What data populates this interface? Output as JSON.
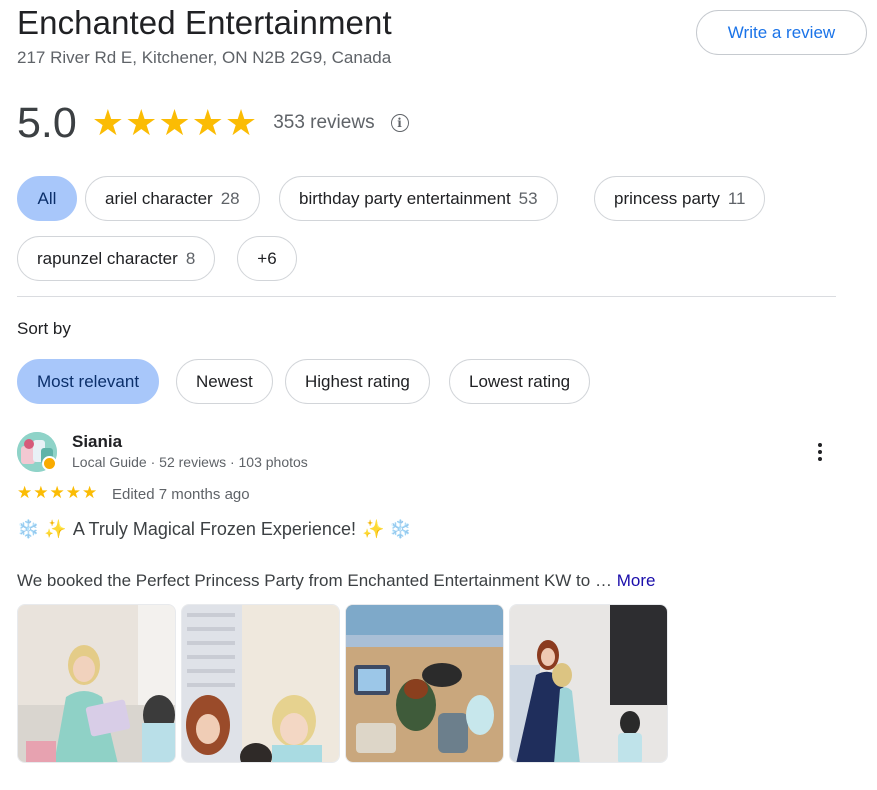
{
  "business": {
    "name": "Enchanted Entertainment",
    "address": "217 River Rd E, Kitchener, ON N2B 2G9, Canada",
    "write_review_label": "Write a review"
  },
  "rating": {
    "value": "5.0",
    "stars": 5,
    "reviews_label": "353 reviews",
    "info_icon": "info-icon"
  },
  "topic_chips": [
    {
      "label": "All",
      "count": "",
      "active": true
    },
    {
      "label": "ariel character",
      "count": "28",
      "active": false
    },
    {
      "label": "birthday party entertainment",
      "count": "53",
      "active": false
    },
    {
      "label": "princess party",
      "count": "11",
      "active": false
    },
    {
      "label": "rapunzel character",
      "count": "8",
      "active": false
    },
    {
      "label": "+6",
      "count": "",
      "active": false
    }
  ],
  "sort": {
    "label": "Sort by",
    "options": [
      {
        "label": "Most relevant",
        "active": true
      },
      {
        "label": "Newest",
        "active": false
      },
      {
        "label": "Highest rating",
        "active": false
      },
      {
        "label": "Lowest rating",
        "active": false
      }
    ]
  },
  "review": {
    "author": "Siania",
    "meta": "Local Guide · 52 reviews · 103 photos",
    "stars": 5,
    "date": "Edited 7 months ago",
    "headline_emoji_left": "❄️ ✨",
    "headline": "A Truly Magical Frozen Experience!",
    "headline_emoji_right": "✨ ❄️",
    "text": "We booked the Perfect Princess Party from Enchanted Entertainment KW to …",
    "more_label": "More",
    "photos": [
      "review-photo-1",
      "review-photo-2",
      "review-photo-3",
      "review-photo-4"
    ]
  },
  "colors": {
    "star": "#fbbc04",
    "active_chip": "#a8c7fa",
    "link_blue": "#1a73e8",
    "more_link": "#1a0dab"
  }
}
